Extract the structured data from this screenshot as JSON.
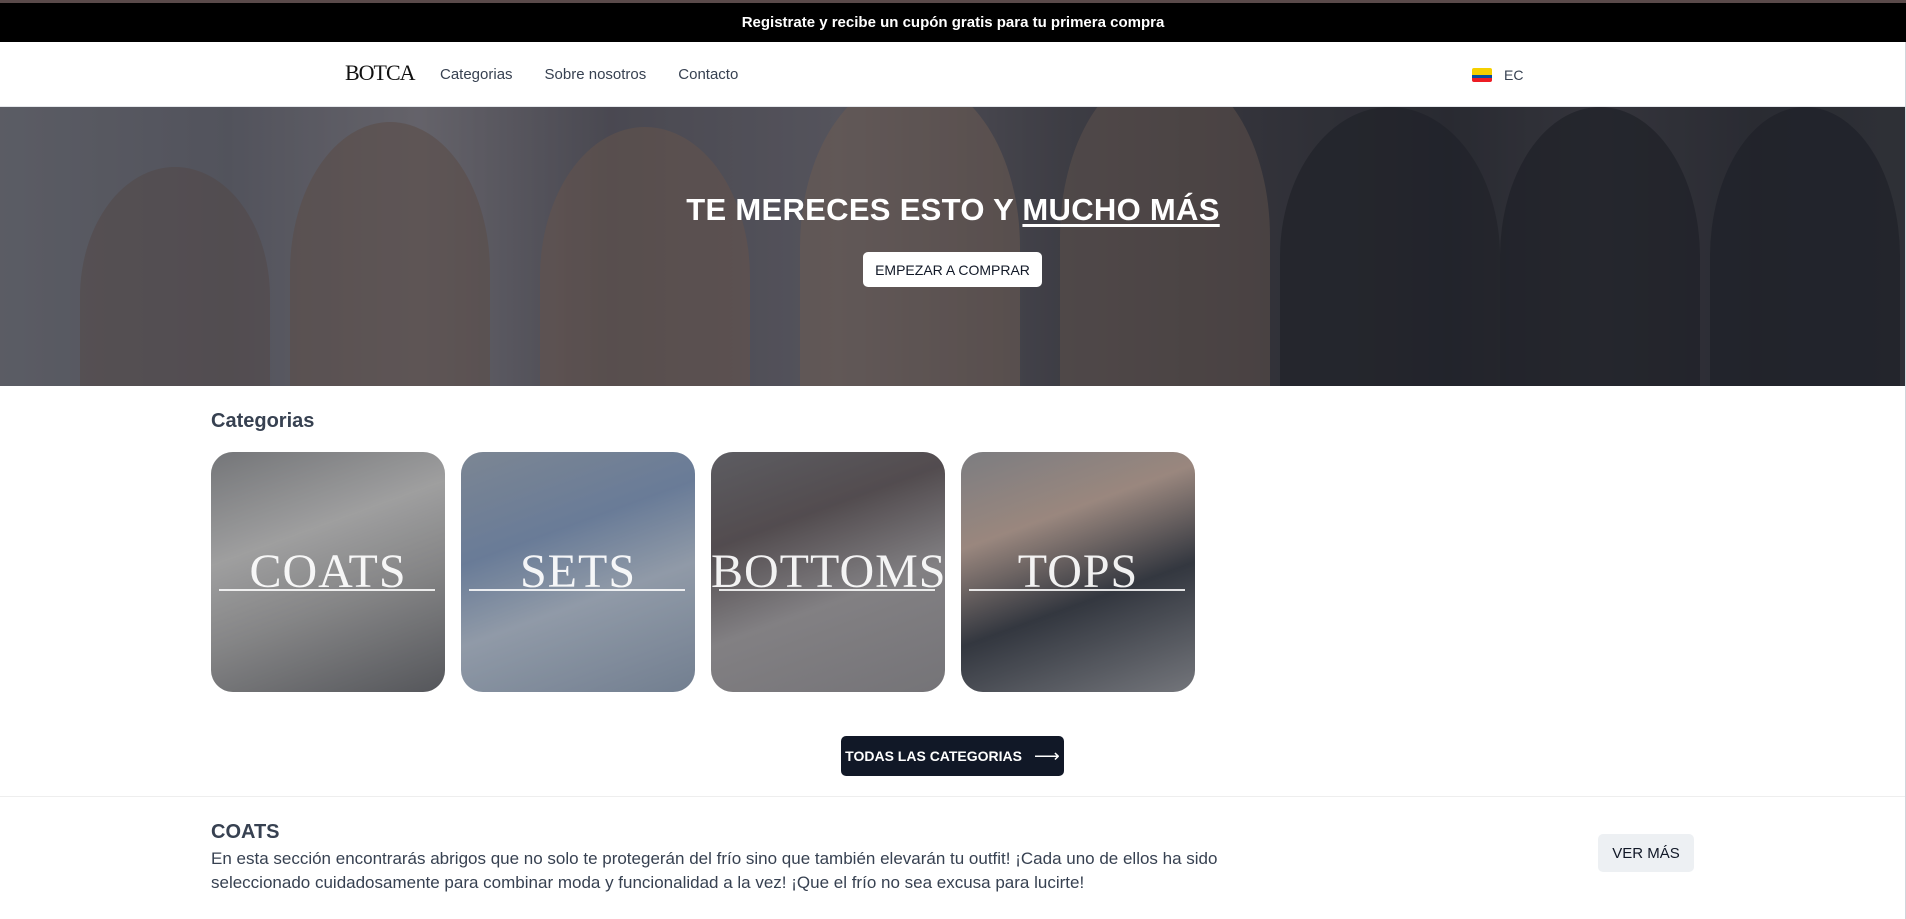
{
  "announcement": {
    "text": "Registrate y recibe un cupón gratis para tu primera compra"
  },
  "navbar": {
    "logo": "BOTCA",
    "links": [
      "Categorias",
      "Sobre nosotros",
      "Contacto"
    ],
    "region": {
      "code": "EC",
      "flag_icon": "ecuador-flag-icon"
    }
  },
  "hero": {
    "title_prefix": "TE MERECES ESTO Y ",
    "title_emphasis": "MUCHO MÁS",
    "cta_label": "EMPEZAR A COMPRAR"
  },
  "categories": {
    "title": "Categorias",
    "items": [
      {
        "label": "COATS"
      },
      {
        "label": "SETS"
      },
      {
        "label": "BOTTOMS"
      },
      {
        "label": "TOPS"
      }
    ],
    "all_button": {
      "label": "TODAS LAS CATEGORIAS",
      "icon": "arrow-right-icon"
    }
  },
  "featured": {
    "title": "COATS",
    "description": "En esta sección encontrarás abrigos que no solo te protegerán del frío sino que también elevarán tu outfit! ¡Cada uno de ellos ha sido seleccionado cuidadosamente para combinar moda y funcionalidad a la vez! ¡Que el frío no sea excusa para lucirte!",
    "button_label": "VER MÁS"
  },
  "colors": {
    "announcement_bg": "#000000",
    "primary_button": "#111827",
    "secondary_button": "#edf0f3"
  }
}
